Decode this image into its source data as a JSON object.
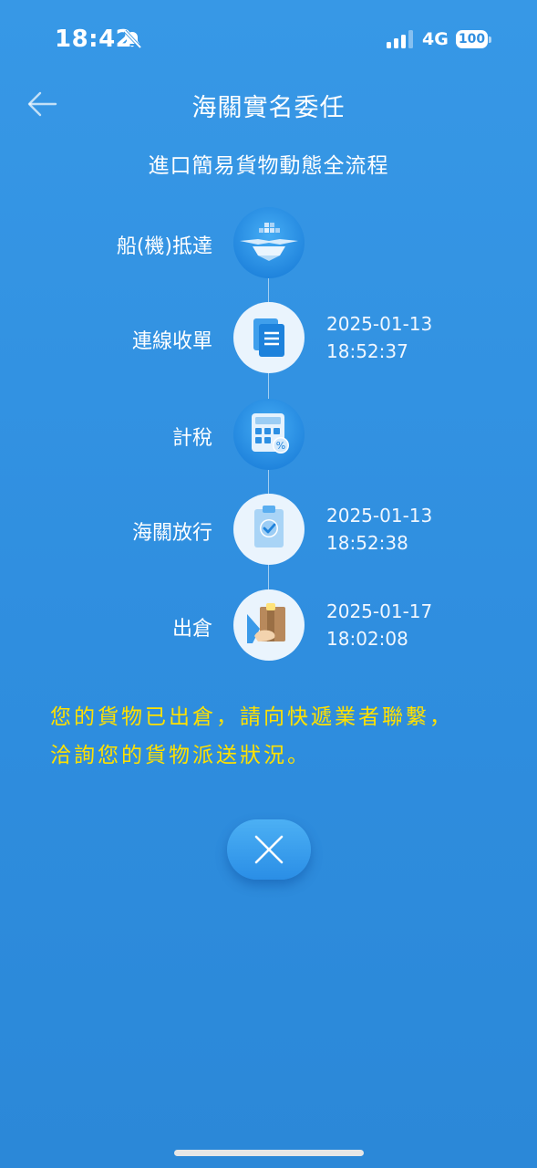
{
  "status_bar": {
    "time": "18:42",
    "network": "4G",
    "battery": "100"
  },
  "header": {
    "title": "海關實名委任"
  },
  "subtitle": "進口簡易貨物動態全流程",
  "steps": [
    {
      "label": "船(機)抵達",
      "icon": "ship-plane-icon",
      "date": "",
      "time": ""
    },
    {
      "label": "連線收單",
      "icon": "document-icon",
      "date": "2025-01-13",
      "time": "18:52:37"
    },
    {
      "label": "計稅",
      "icon": "calculator-icon",
      "date": "",
      "time": ""
    },
    {
      "label": "海關放行",
      "icon": "clipboard-check-icon",
      "date": "2025-01-13",
      "time": "18:52:38"
    },
    {
      "label": "出倉",
      "icon": "package-handoff-icon",
      "date": "2025-01-17",
      "time": "18:02:08"
    }
  ],
  "notice": {
    "line1": "您的貨物已出倉，請向快遞業者聯繫，",
    "line2": "洽詢您的貨物派送狀況。"
  },
  "colors": {
    "background": "#2f8edf",
    "notice_text": "#ffe100",
    "accent_icon": "#1f87e0"
  }
}
